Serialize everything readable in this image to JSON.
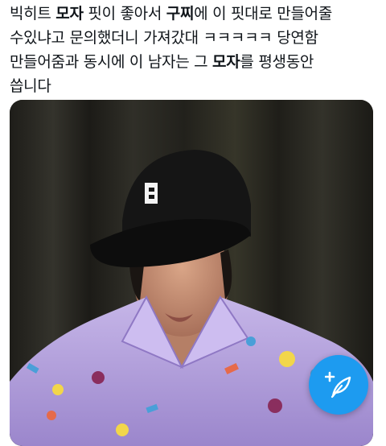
{
  "tweet": {
    "text_line1_a": "빅히트 ",
    "text_line1_b": "모자",
    "text_line1_c": " 핏이 좋아서 ",
    "text_line1_d": "구찌",
    "text_line1_e": "에 이 핏대로 만들어줄",
    "text_line2": "수있냐고 문의했더니 가져갔대 ㅋㅋㅋㅋㅋ 당연함",
    "text_line3": "만들어줌과 동시에 이 남자는 그 ",
    "text_line3_b": "모자",
    "text_line3_c": "를 평생동안",
    "text_line4": "씁니다"
  },
  "media": {
    "cap_logo": "B",
    "colors": {
      "curtain": "#2b2a24",
      "cap": "#151515",
      "shirt": "#b9a6e0"
    }
  },
  "compose_fab": {
    "icon": "compose-feather-plus-icon",
    "color": "#1d9bf0"
  }
}
